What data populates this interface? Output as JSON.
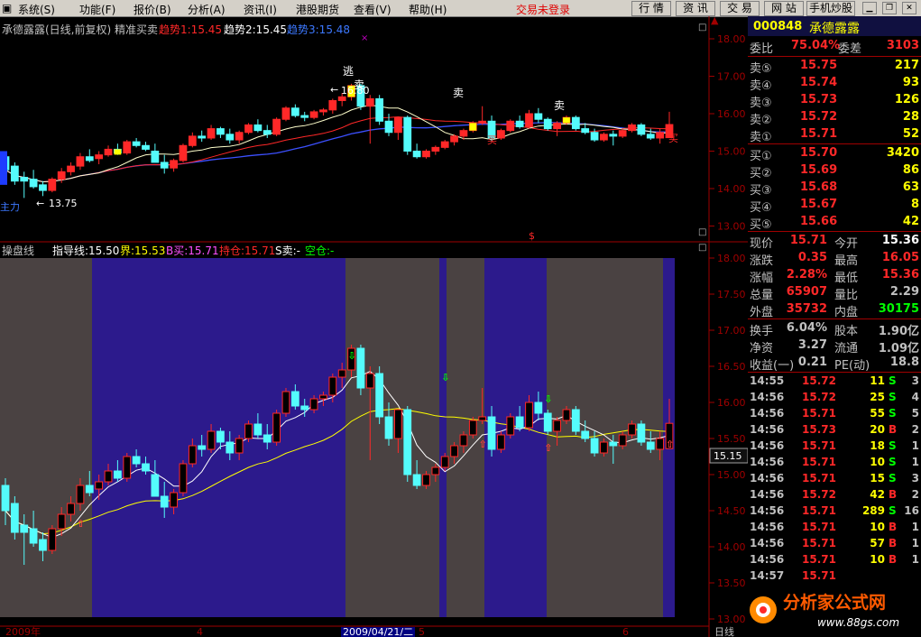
{
  "menu": {
    "items": [
      "系统(S)",
      "功能(F)",
      "报价(B)",
      "分析(A)",
      "资讯(I)",
      "港股期货",
      "查看(V)",
      "帮助(H)"
    ],
    "warning": "交易未登录",
    "tabs": [
      "行 情",
      "资 讯",
      "交 易",
      "网 站",
      "手机炒股"
    ]
  },
  "upper": {
    "title": "承德露露(日线,前复权) 精准买卖",
    "trend1": "趋势1:15.45",
    "trend2": "趋势2:15.45",
    "trend3": "趋势3:15.48",
    "ann_flee": "逃",
    "ann_high": "16.80",
    "ann_sell": "卖",
    "ann_buy": "买",
    "ann_low": "13.75",
    "main_force": "主力",
    "dollar": "$",
    "yaxis": [
      "18.00",
      "17.00",
      "16.00",
      "15.00",
      "14.00",
      "13.00"
    ],
    "marker": "×"
  },
  "lower": {
    "title": "操盘线",
    "guide": "指导线:15.50",
    "bound": "界:15.53",
    "bbuy": "B买:15.71",
    "hold": "持仓:15.71",
    "ssell": "S卖:-",
    "empty": "空仓:-",
    "yaxis": [
      "18.00",
      "17.50",
      "17.00",
      "16.50",
      "16.00",
      "15.50",
      "15.00",
      "14.50",
      "14.00",
      "13.50",
      "13.00"
    ],
    "price_tag": "15.15"
  },
  "xaxis": {
    "labels": [
      "2009年",
      "4",
      "2009/04/21/二",
      "5",
      "6"
    ],
    "period": "日线"
  },
  "colors": {
    "up": "#ff2828",
    "down": "#54fcfc",
    "bg_band_gray": "#4a4242",
    "bg_band_blue": "#2c1a8c",
    "yellow": "#ffff00"
  },
  "quote": {
    "code": "000848",
    "name": "承德露露",
    "ratio_label": "委比",
    "ratio": "75.04%",
    "diff_label": "委差",
    "diff": "3103",
    "asks": [
      {
        "label": "卖⑤",
        "price": "15.75",
        "vol": "217"
      },
      {
        "label": "卖④",
        "price": "15.74",
        "vol": "93"
      },
      {
        "label": "卖③",
        "price": "15.73",
        "vol": "126"
      },
      {
        "label": "卖②",
        "price": "15.72",
        "vol": "28"
      },
      {
        "label": "卖①",
        "price": "15.71",
        "vol": "52"
      }
    ],
    "bids": [
      {
        "label": "买①",
        "price": "15.70",
        "vol": "3420"
      },
      {
        "label": "买②",
        "price": "15.69",
        "vol": "86"
      },
      {
        "label": "买③",
        "price": "15.68",
        "vol": "63"
      },
      {
        "label": "买④",
        "price": "15.67",
        "vol": "8"
      },
      {
        "label": "买⑤",
        "price": "15.66",
        "vol": "42"
      }
    ],
    "stats1": [
      {
        "l1": "现价",
        "v1": "15.71",
        "l2": "今开",
        "v2": "15.36"
      },
      {
        "l1": "涨跌",
        "v1": "0.35",
        "l2": "最高",
        "v2": "16.05"
      },
      {
        "l1": "涨幅",
        "v1": "2.28%",
        "l2": "最低",
        "v2": "15.36"
      },
      {
        "l1": "总量",
        "v1": "65907",
        "l2": "量比",
        "v2": "2.29"
      },
      {
        "l1": "外盘",
        "v1": "35732",
        "l2": "内盘",
        "v2": "30175"
      }
    ],
    "stats2": [
      {
        "l1": "换手",
        "v1": "6.04%",
        "l2": "股本",
        "v2": "1.90亿"
      },
      {
        "l1": "净资",
        "v1": "3.27",
        "l2": "流通",
        "v2": "1.09亿"
      },
      {
        "l1": "收益(一)",
        "v1": "0.21",
        "l2": "PE(动)",
        "v2": "18.8"
      }
    ],
    "ticks": [
      {
        "t": "14:55",
        "p": "15.72",
        "v": "11",
        "s": "S",
        "n": "3"
      },
      {
        "t": "14:56",
        "p": "15.72",
        "v": "25",
        "s": "S",
        "n": "4"
      },
      {
        "t": "14:56",
        "p": "15.71",
        "v": "55",
        "s": "S",
        "n": "5"
      },
      {
        "t": "14:56",
        "p": "15.73",
        "v": "20",
        "s": "B",
        "n": "2"
      },
      {
        "t": "14:56",
        "p": "15.71",
        "v": "18",
        "s": "S",
        "n": "1"
      },
      {
        "t": "14:56",
        "p": "15.71",
        "v": "10",
        "s": "S",
        "n": "1"
      },
      {
        "t": "14:56",
        "p": "15.71",
        "v": "15",
        "s": "S",
        "n": "3"
      },
      {
        "t": "14:56",
        "p": "15.72",
        "v": "42",
        "s": "B",
        "n": "2"
      },
      {
        "t": "14:56",
        "p": "15.71",
        "v": "289",
        "s": "S",
        "n": "16"
      },
      {
        "t": "14:56",
        "p": "15.71",
        "v": "10",
        "s": "B",
        "n": "1"
      },
      {
        "t": "14:56",
        "p": "15.71",
        "v": "57",
        "s": "B",
        "n": "1"
      },
      {
        "t": "14:56",
        "p": "15.71",
        "v": "10",
        "s": "B",
        "n": "1"
      },
      {
        "t": "14:57",
        "p": "15.71",
        "v": "",
        "s": "",
        "n": ""
      }
    ]
  },
  "logo": {
    "text": "分析家公式网",
    "url": "www.88gs.com"
  },
  "chart_data": [
    {
      "type": "candlestick",
      "title": "承德露露(日线,前复权) 精准买卖",
      "ylim": [
        13.0,
        18.2
      ],
      "candles": [
        [
          14.85,
          14.95,
          14.3,
          14.5
        ],
        [
          14.6,
          14.7,
          14.1,
          14.2
        ],
        [
          14.3,
          14.45,
          13.75,
          14.2
        ],
        [
          14.25,
          14.5,
          14.0,
          14.05
        ],
        [
          14.1,
          14.2,
          13.8,
          13.95
        ],
        [
          13.95,
          14.3,
          13.9,
          14.25
        ],
        [
          14.25,
          14.55,
          14.15,
          14.45
        ],
        [
          14.45,
          14.7,
          14.35,
          14.6
        ],
        [
          14.6,
          14.95,
          14.5,
          14.85
        ],
        [
          14.85,
          15.05,
          14.7,
          14.75
        ],
        [
          14.8,
          15.0,
          14.65,
          14.9
        ],
        [
          14.9,
          15.15,
          14.85,
          15.05
        ],
        [
          15.05,
          15.2,
          14.9,
          14.95
        ],
        [
          14.95,
          15.3,
          14.9,
          15.25
        ],
        [
          15.25,
          15.35,
          15.1,
          15.15
        ],
        [
          15.15,
          15.25,
          15.0,
          15.05
        ],
        [
          15.0,
          15.2,
          14.9,
          14.7
        ],
        [
          14.7,
          14.9,
          14.4,
          14.55
        ],
        [
          14.55,
          14.8,
          14.45,
          14.75
        ],
        [
          14.75,
          15.2,
          14.7,
          15.15
        ],
        [
          15.15,
          15.5,
          15.1,
          15.4
        ],
        [
          15.4,
          15.55,
          15.25,
          15.35
        ],
        [
          15.35,
          15.7,
          15.3,
          15.6
        ],
        [
          15.6,
          15.65,
          15.35,
          15.45
        ],
        [
          15.45,
          15.6,
          15.2,
          15.3
        ],
        [
          15.3,
          15.55,
          15.2,
          15.5
        ],
        [
          15.5,
          15.75,
          15.45,
          15.7
        ],
        [
          15.7,
          15.85,
          15.5,
          15.55
        ],
        [
          15.55,
          15.7,
          15.35,
          15.45
        ],
        [
          15.45,
          15.9,
          15.4,
          15.85
        ],
        [
          15.85,
          16.2,
          15.8,
          16.15
        ],
        [
          16.15,
          16.25,
          15.9,
          15.95
        ],
        [
          15.95,
          16.05,
          15.8,
          15.9
        ],
        [
          15.9,
          16.1,
          15.85,
          16.05
        ],
        [
          16.05,
          16.15,
          15.95,
          16.1
        ],
        [
          16.1,
          16.4,
          16.0,
          16.35
        ],
        [
          16.35,
          16.55,
          16.2,
          16.45
        ],
        [
          16.45,
          16.8,
          16.35,
          16.75
        ],
        [
          16.75,
          16.8,
          16.1,
          16.2
        ],
        [
          16.2,
          16.5,
          15.2,
          16.4
        ],
        [
          16.4,
          16.5,
          15.7,
          15.8
        ],
        [
          15.8,
          16.0,
          15.4,
          15.5
        ],
        [
          15.5,
          15.9,
          15.3,
          15.9
        ],
        [
          15.9,
          15.95,
          14.9,
          15.0
        ],
        [
          15.0,
          15.2,
          14.8,
          14.85
        ],
        [
          14.85,
          15.05,
          14.8,
          15.0
        ],
        [
          15.0,
          15.15,
          14.9,
          15.1
        ],
        [
          15.1,
          15.3,
          15.05,
          15.25
        ],
        [
          15.25,
          15.45,
          15.15,
          15.4
        ],
        [
          15.4,
          15.6,
          15.3,
          15.55
        ],
        [
          15.55,
          15.8,
          15.5,
          15.75
        ],
        [
          15.75,
          16.2,
          15.7,
          15.8
        ],
        [
          15.8,
          15.95,
          15.25,
          15.35
        ],
        [
          15.35,
          15.6,
          15.3,
          15.55
        ],
        [
          15.55,
          15.85,
          15.5,
          15.8
        ],
        [
          15.8,
          15.95,
          15.6,
          15.65
        ],
        [
          15.65,
          16.1,
          15.6,
          16.0
        ],
        [
          16.0,
          16.15,
          15.75,
          15.85
        ],
        [
          15.85,
          15.9,
          15.55,
          15.6
        ],
        [
          15.6,
          15.8,
          15.4,
          15.75
        ],
        [
          15.75,
          15.95,
          15.7,
          15.9
        ],
        [
          15.9,
          15.95,
          15.55,
          15.6
        ],
        [
          15.6,
          15.75,
          15.45,
          15.5
        ],
        [
          15.5,
          15.6,
          15.25,
          15.3
        ],
        [
          15.3,
          15.5,
          15.25,
          15.45
        ],
        [
          15.45,
          15.55,
          15.15,
          15.4
        ],
        [
          15.4,
          15.6,
          15.35,
          15.55
        ],
        [
          15.55,
          15.75,
          15.5,
          15.7
        ],
        [
          15.7,
          15.75,
          15.4,
          15.45
        ],
        [
          15.45,
          15.6,
          15.3,
          15.35
        ],
        [
          15.35,
          15.6,
          15.2,
          15.5
        ],
        [
          15.36,
          16.05,
          15.36,
          15.71
        ]
      ]
    }
  ]
}
